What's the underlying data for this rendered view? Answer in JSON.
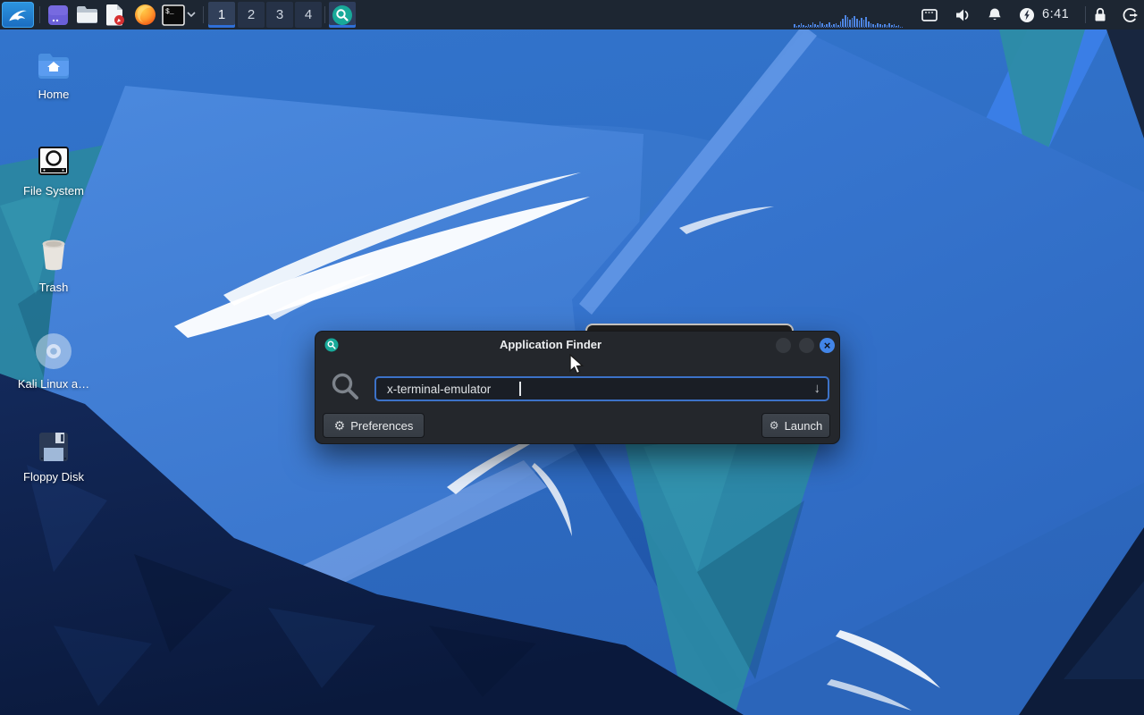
{
  "panel": {
    "workspaces": [
      "1",
      "2",
      "3",
      "4"
    ],
    "clock": "6:41",
    "terminal_glyph": "$_",
    "load_bars": [
      3,
      1,
      2,
      4,
      2,
      1,
      3,
      2,
      5,
      3,
      2,
      6,
      4,
      2,
      3,
      5,
      2,
      3,
      4,
      2,
      6,
      9,
      13,
      11,
      8,
      10,
      12,
      9,
      7,
      10,
      8,
      11,
      6,
      4,
      3,
      2,
      4,
      3,
      2,
      3,
      2,
      4,
      2,
      3,
      1,
      2
    ],
    "icons": [
      "kali-menu",
      "window-app",
      "file-manager",
      "text-editor",
      "firefox",
      "terminal",
      "chevron-down",
      "app-finder",
      "display",
      "volume",
      "notifications",
      "power-manager",
      "lock",
      "logout"
    ]
  },
  "desktop": {
    "icons": [
      {
        "label": "Home"
      },
      {
        "label": "File System"
      },
      {
        "label": "Trash"
      },
      {
        "label": "Kali Linux a…"
      },
      {
        "label": "Floppy Disk"
      }
    ]
  },
  "finder": {
    "title": "Application Finder",
    "input": {
      "value": "x-terminal-emulator",
      "dropdown_glyph": "↓"
    },
    "buttons": {
      "preferences": "Preferences",
      "launch": "Launch"
    },
    "glyphs": {
      "gear": "⚙",
      "close": "×"
    }
  },
  "colors": {
    "accent": "#2f6fd8",
    "close_button": "#4285e8",
    "finder_icon": "#18a999",
    "panel_bg": "#1d2632",
    "dialog_bg": "#24272c",
    "input_border": "#3c72c8"
  }
}
